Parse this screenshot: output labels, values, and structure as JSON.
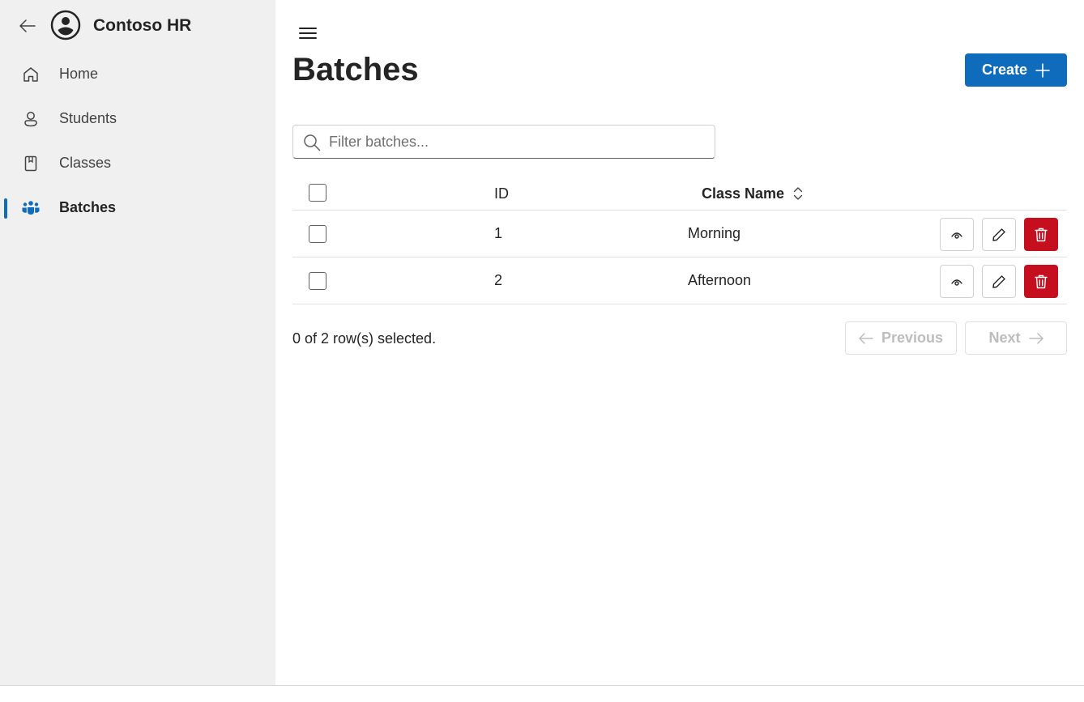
{
  "app": {
    "title": "Contoso HR"
  },
  "nav": {
    "items": [
      {
        "label": "Home",
        "icon": "home-icon"
      },
      {
        "label": "Students",
        "icon": "person-icon"
      },
      {
        "label": "Classes",
        "icon": "book-icon"
      },
      {
        "label": "Batches",
        "icon": "people-team-icon",
        "active": true
      }
    ]
  },
  "page": {
    "title": "Batches",
    "create_label": "Create",
    "filter_placeholder": "Filter batches..."
  },
  "table": {
    "columns": [
      "ID",
      "Class Name"
    ],
    "rows": [
      {
        "id": "1",
        "class_name": "Morning"
      },
      {
        "id": "2",
        "class_name": "Afternoon"
      }
    ]
  },
  "footer": {
    "selection_text": "0 of 2 row(s) selected.",
    "previous_label": "Previous",
    "next_label": "Next"
  },
  "colors": {
    "accent": "#0f6cbd",
    "danger": "#c50f1f",
    "sidebar_bg": "#f0f0f0"
  }
}
